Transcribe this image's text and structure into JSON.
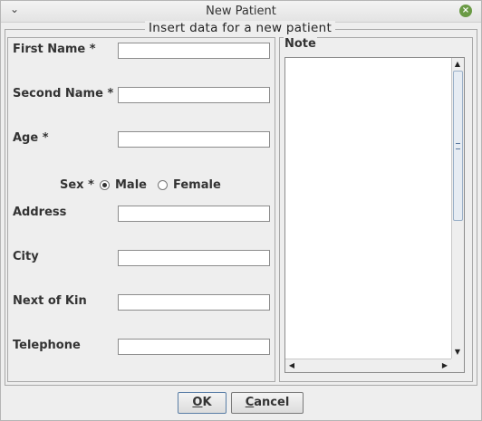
{
  "window": {
    "title": "New Patient"
  },
  "group": {
    "title": "Insert data for a new patient"
  },
  "form": {
    "fields": [
      {
        "label": "First Name *",
        "value": ""
      },
      {
        "label": "Second Name *",
        "value": ""
      },
      {
        "label": "Age *",
        "value": ""
      },
      {
        "label": "Address",
        "value": ""
      },
      {
        "label": "City",
        "value": ""
      },
      {
        "label": "Next of Kin",
        "value": ""
      },
      {
        "label": "Telephone",
        "value": ""
      }
    ],
    "sex": {
      "label": "Sex *",
      "options": [
        "Male",
        "Female"
      ],
      "selected": "Male"
    }
  },
  "note": {
    "title": "Note",
    "value": ""
  },
  "buttons": {
    "ok_mnemonic": "O",
    "ok_rest": "K",
    "cancel_mnemonic": "C",
    "cancel_rest": "ancel"
  },
  "icons": {
    "menu": "chevron-down-icon",
    "close": "close-icon"
  }
}
